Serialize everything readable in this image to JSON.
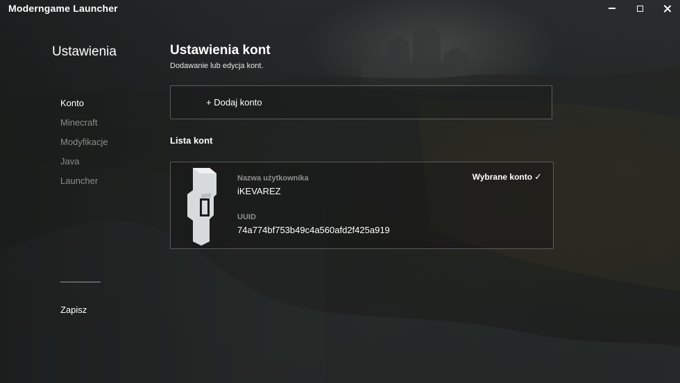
{
  "window": {
    "title": "Moderngame Launcher",
    "controls": {
      "minimize": "minimize-icon",
      "maximize": "maximize-icon",
      "close": "close-icon"
    }
  },
  "sidebar": {
    "title": "Ustawienia",
    "items": [
      {
        "label": "Konto",
        "active": true
      },
      {
        "label": "Minecraft",
        "active": false
      },
      {
        "label": "Modyfikacje",
        "active": false
      },
      {
        "label": "Java",
        "active": false
      },
      {
        "label": "Launcher",
        "active": false
      }
    ],
    "save_label": "Zapisz"
  },
  "main": {
    "title": "Ustawienia kont",
    "subtitle": "Dodawanie lub edycja kont.",
    "add_account_label": "+ Dodaj konto",
    "list_title": "Lista kont",
    "accounts": [
      {
        "username_label": "Nazwa użytkownika",
        "username": "iKEVAREZ",
        "uuid_label": "UUID",
        "uuid": "74a774bf753b49c4a560afd2f425a919",
        "selected_label": "Wybrane konto",
        "selected_icon": "checkmark-icon",
        "avatar_icon": "player-avatar-icon"
      }
    ]
  },
  "colors": {
    "text_primary": "#ffffff",
    "text_muted": "#8b8d8c",
    "card_border": "#5a5c5b",
    "avatar_fill": "#d8dbdc"
  }
}
